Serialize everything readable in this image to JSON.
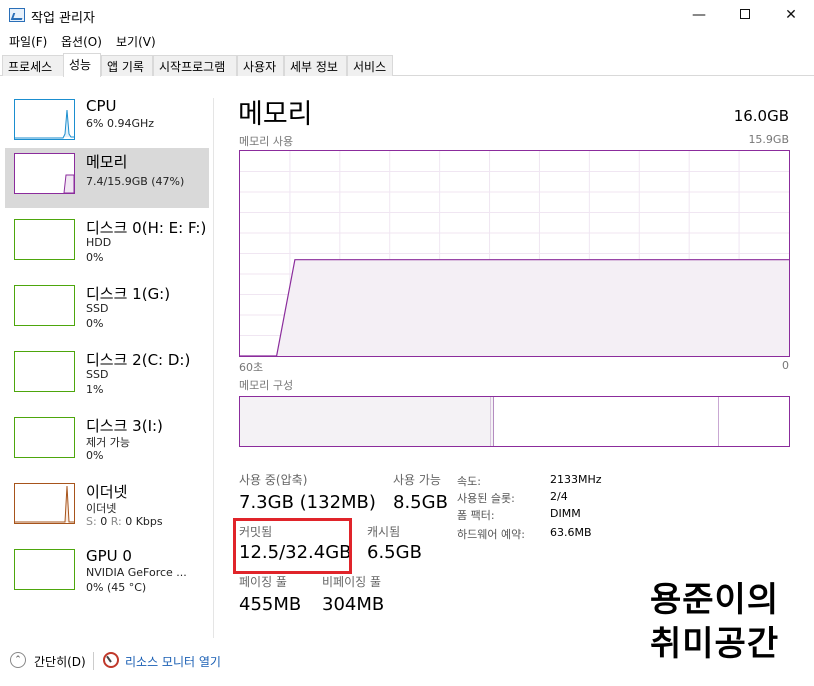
{
  "window": {
    "title": "작업 관리자",
    "minimize": "—",
    "close": "✕"
  },
  "menu": [
    "파일(F)",
    "옵션(O)",
    "보기(V)"
  ],
  "tabs": [
    "프로세스",
    "성능",
    "앱 기록",
    "시작프로그램",
    "사용자",
    "세부 정보",
    "서비스"
  ],
  "active_tab": "성능",
  "devices": [
    {
      "name": "CPU",
      "line1": "6% 0.94GHz",
      "line2": "",
      "color": "#1b8ecf"
    },
    {
      "name": "메모리",
      "line1": "7.4/15.9GB (47%)",
      "line2": "",
      "color": "#8b2c9c"
    },
    {
      "name": "디스크 0(H: E: F:)",
      "line1": "HDD",
      "line2": "0%",
      "color": "#4da60c"
    },
    {
      "name": "디스크 1(G:)",
      "line1": "SSD",
      "line2": "0%",
      "color": "#4da60c"
    },
    {
      "name": "디스크 2(C: D:)",
      "line1": "SSD",
      "line2": "1%",
      "color": "#4da60c"
    },
    {
      "name": "디스크 3(I:)",
      "line1": "제거 가능",
      "line2": "0%",
      "color": "#4da60c"
    },
    {
      "name": "이더넷",
      "line1": "이더넷",
      "line2_s": "S:",
      "line2_s_val": "0",
      "line2_r": "R:",
      "line2_r_val": "0 Kbps",
      "color": "#a7541b"
    },
    {
      "name": "GPU 0",
      "line1": "NVIDIA GeForce ...",
      "line2": "0% (45 °C)",
      "color": "#4da60c"
    }
  ],
  "main": {
    "title": "메모리",
    "total": "16.0GB",
    "usage_label": "메모리 사용",
    "usage_max": "15.9GB",
    "time_left": "60초",
    "time_right": "0",
    "composition_label": "메모리 구성"
  },
  "stats": {
    "in_use_label": "사용 중(압축)",
    "in_use_value": "7.3GB (132MB)",
    "available_label": "사용 가능",
    "available_value": "8.5GB",
    "committed_label": "커밋됨",
    "committed_value": "12.5/32.4GB",
    "cached_label": "캐시됨",
    "cached_value": "6.5GB",
    "paged_label": "페이징 풀",
    "paged_value": "455MB",
    "nonpaged_label": "비페이징 풀",
    "nonpaged_value": "304MB"
  },
  "specs": [
    {
      "key": "속도:",
      "value": "2133MHz"
    },
    {
      "key": "사용된 슬롯:",
      "value": "2/4"
    },
    {
      "key": "폼 팩터:",
      "value": "DIMM"
    },
    {
      "key": "하드웨어 예약:",
      "value": "63.6MB"
    }
  ],
  "bottom": {
    "fewer_details": "간단히(D)",
    "resource_monitor": "리소스 모니터 열기"
  },
  "watermark": [
    "용준이의",
    "취미공간"
  ],
  "memory_usage_series": {
    "x_seconds_ago": [
      60,
      57,
      56,
      54,
      0
    ],
    "percent": [
      0,
      0,
      0,
      47,
      47
    ]
  }
}
